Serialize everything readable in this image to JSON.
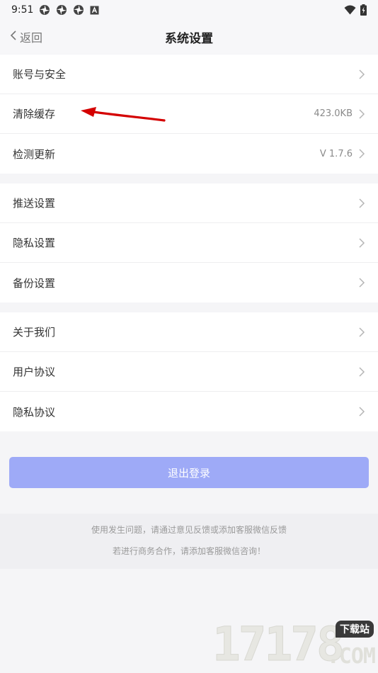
{
  "status_bar": {
    "time": "9:51"
  },
  "nav": {
    "back_label": "返回",
    "title": "系统设置"
  },
  "groups": [
    {
      "items": [
        {
          "label": "账号与安全",
          "value": ""
        },
        {
          "label": "清除缓存",
          "value": "423.0KB"
        },
        {
          "label": "检测更新",
          "value": "V 1.7.6"
        }
      ]
    },
    {
      "items": [
        {
          "label": "推送设置",
          "value": ""
        },
        {
          "label": "隐私设置",
          "value": ""
        },
        {
          "label": "备份设置",
          "value": ""
        }
      ]
    },
    {
      "items": [
        {
          "label": "关于我们",
          "value": ""
        },
        {
          "label": "用户协议",
          "value": ""
        },
        {
          "label": "隐私协议",
          "value": ""
        }
      ]
    }
  ],
  "logout": {
    "label": "退出登录",
    "color": "#9eaaf7"
  },
  "footer": {
    "line1": "使用发生问题，请通过意见反馈或添加客服微信反馈",
    "line2": "若进行商务合作，请添加客服微信咨询！"
  },
  "watermark": {
    "digits": "17178",
    "badge": "下载站",
    "domain": ".COM"
  },
  "colors": {
    "annotation_arrow": "#d40000"
  }
}
